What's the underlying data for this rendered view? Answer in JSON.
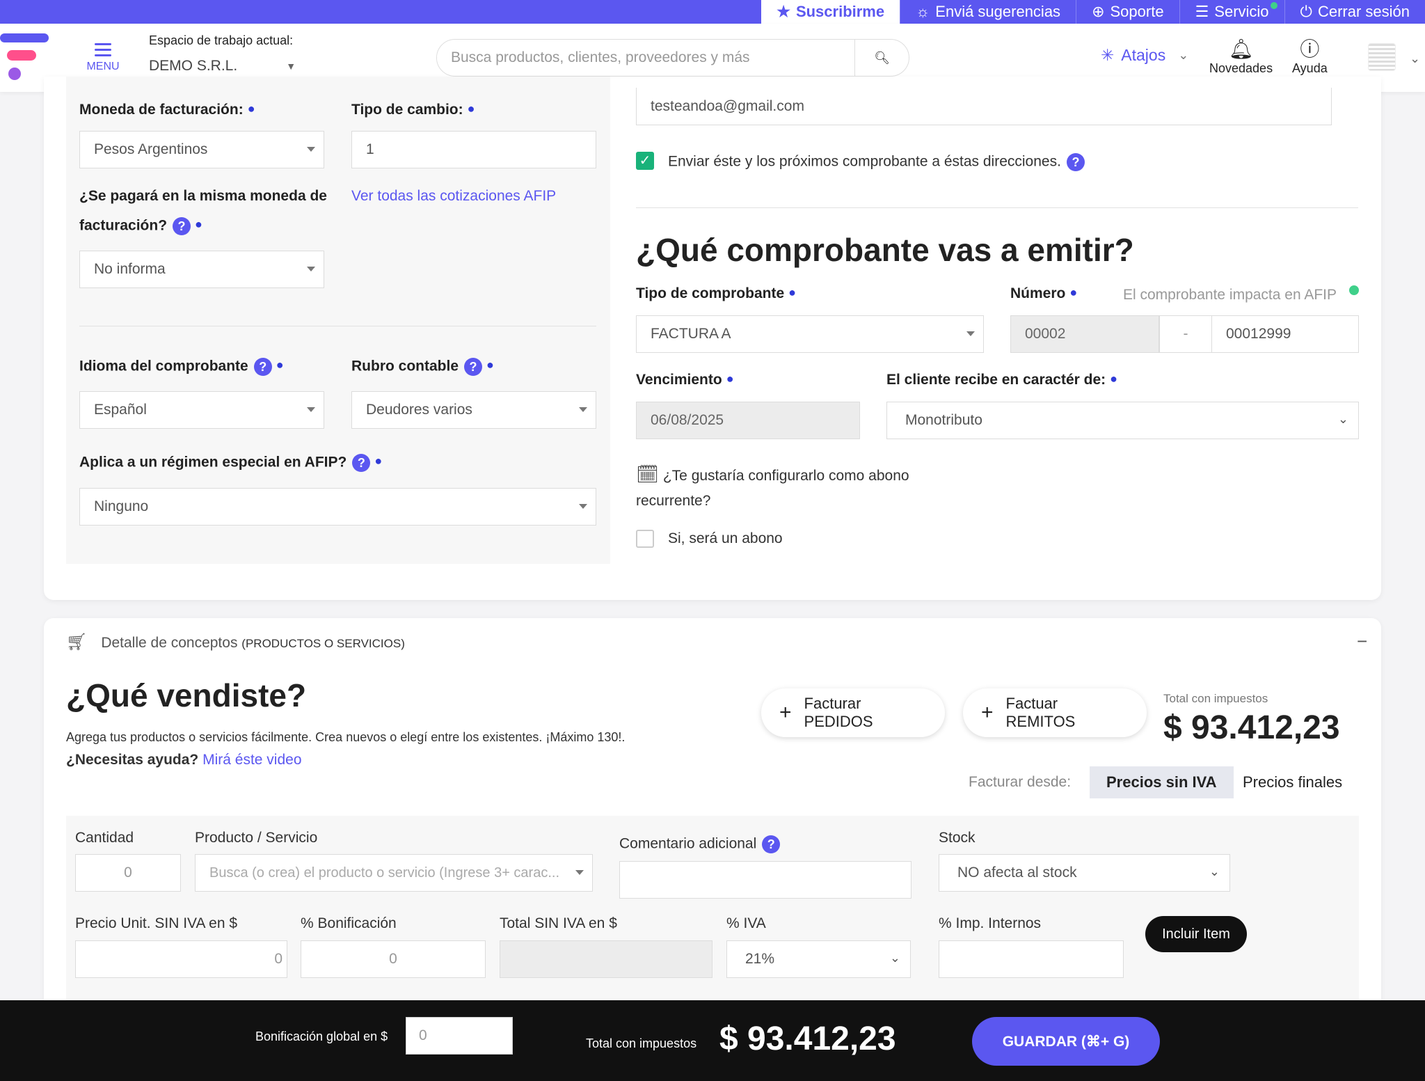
{
  "topbar": {
    "subscribe": "Suscribirme",
    "suggestions": "Enviá sugerencias",
    "support": "Soporte",
    "service": "Servicio",
    "logout": "Cerrar sesión"
  },
  "header": {
    "menu_label": "MENU",
    "workspace_label": "Espacio de trabajo actual:",
    "workspace_value": "DEMO S.R.L.",
    "search_placeholder": "Busca productos, clientes, proveedores y más",
    "shortcuts_label": "Atajos",
    "news_label": "Novedades",
    "help_label": "Ayuda"
  },
  "billing": {
    "currency_label": "Moneda de facturación:",
    "currency_value": "Pesos Argentinos",
    "exchange_label": "Tipo de cambio:",
    "exchange_value": "1",
    "same_currency_label_line1": "¿Se pagará en la misma moneda de",
    "same_currency_label_line2": "facturación?",
    "afip_rates_link": "Ver todas las cotizaciones AFIP",
    "same_currency_value": "No informa",
    "language_label": "Idioma del comprobante",
    "language_value": "Español",
    "account_label": "Rubro contable",
    "account_value": "Deudores varios",
    "regime_label": "Aplica a un régimen especial en AFIP?",
    "regime_value": "Ninguno"
  },
  "email": {
    "value": "testeandoa@gmail.com",
    "send_checkbox_label": "Enviar éste y los próximos comprobante a éstas direcciones."
  },
  "voucher": {
    "title": "¿Qué comprobante vas a emitir?",
    "type_label": "Tipo de comprobante",
    "type_value": "FACTURA A",
    "number_label": "Número",
    "afip_impact_label": "El comprobante impacta en AFIP",
    "point_of_sale": "00002",
    "separator": "-",
    "number_value": "00012999",
    "due_label": "Vencimiento",
    "due_value": "06/08/2025",
    "client_receives_label": "El cliente recibe en caractér de:",
    "client_receives_value": "Monotributo",
    "recurring_question_line1": "¿Te gustaría configurarlo como abono",
    "recurring_question_line2": "recurrente?",
    "recurring_checkbox_label": "Si, será un abono"
  },
  "detail": {
    "section_label": "Detalle de conceptos",
    "section_sublabel": "(PRODUCTOS O SERVICIOS)",
    "collapse_symbol": "−",
    "title": "¿Qué vendiste?",
    "description": "Agrega tus productos o servicios fácilmente. Crea nuevos o elegí entre los existentes. ¡Máximo 130!.",
    "help_question": "¿Necesitas ayuda?",
    "help_link": "Mirá éste video",
    "bill_orders_button": "Facturar PEDIDOS",
    "bill_remitos_button": "Factuar REMITOS",
    "total_label": "Total con impuestos",
    "total_value": "$ 93.412,23",
    "bill_from_label": "Facturar desde:",
    "prices_without_vat": "Precios sin IVA",
    "final_prices": "Precios finales"
  },
  "item_form": {
    "quantity_label": "Cantidad",
    "quantity_value": "0",
    "product_label": "Producto / Servicio",
    "product_placeholder": "Busca (o crea) el producto o servicio (Ingrese 3+ carac...",
    "comment_label": "Comentario adicional",
    "stock_label": "Stock",
    "stock_value": "NO afecta al stock",
    "unit_price_label": "Precio Unit. SIN IVA en $",
    "unit_price_value": "0",
    "discount_label": "% Bonificación",
    "discount_value": "0",
    "total_no_vat_label": "Total SIN IVA en $",
    "vat_label": "% IVA",
    "vat_value": "21%",
    "internal_tax_label": "% Imp. Internos",
    "include_button": "Incluir Item"
  },
  "bottom": {
    "global_discount_label": "Bonificación global en $",
    "global_discount_value": "0",
    "total_label": "Total con impuestos",
    "total_value": "$ 93.412,23",
    "save_button": "GUARDAR (⌘+ G)"
  },
  "colors": {
    "brand": "#5b57f0",
    "success": "#19b27a",
    "dark": "#111111"
  }
}
